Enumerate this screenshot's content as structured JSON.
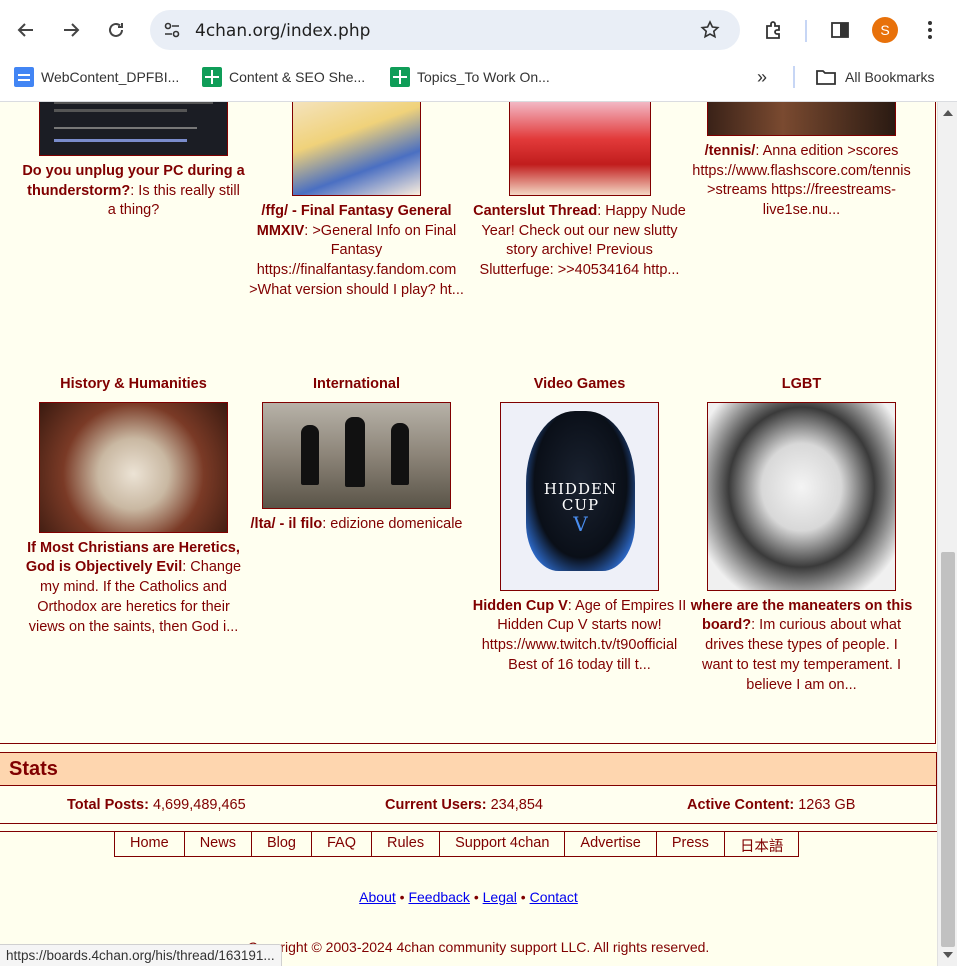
{
  "browser": {
    "url": "4chan.org/index.php",
    "profile_initial": "S",
    "bookmarks": [
      {
        "label": "WebContent_DPFBI...",
        "icon": "docs-icon"
      },
      {
        "label": "Content & SEO She...",
        "icon": "sheets-icon"
      },
      {
        "label": "Topics_To Work On...",
        "icon": "sheets-icon"
      }
    ],
    "all_bookmarks": "All Bookmarks",
    "overflow": "»"
  },
  "top_row": [
    {
      "title": "Do you unplug your PC during a thunderstorm?",
      "text": ": Is this really still a thing?"
    },
    {
      "title": "/ffg/ - Final Fantasy General MMXIV",
      "text": ": >General Info on Final Fantasy https://finalfantasy.fandom.com >What version should I play? ht..."
    },
    {
      "title": "Canterslut Thread",
      "text": ": Happy Nude Year! Check out our new slutty story archive! Previous Slutterfuge: >>40534164 http..."
    },
    {
      "title": "/tennis/",
      "text": ": Anna edition >scores https://www.flashscore.com/tennis >streams https://freestreams-live1se.nu..."
    }
  ],
  "bottom_row": [
    {
      "board": "History & Humanities",
      "title": "If Most Christians are Heretics, God is Objectively Evil",
      "text": ": Change my mind. If the Catholics and Orthodox are heretics for their views on the saints, then God i..."
    },
    {
      "board": "International",
      "title": "/lta/ - il filo",
      "text": ": edizione domenicale"
    },
    {
      "board": "Video Games",
      "title": "Hidden Cup V",
      "text": ": Age of Empires II Hidden Cup V starts now! https://www.twitch.tv/t90official Best of 16 today till t..."
    },
    {
      "board": "LGBT",
      "title": "where are the maneaters on this board?",
      "text": ": Im curious about what drives these types of people. I want to test my temperament. I believe I am on..."
    }
  ],
  "stats": {
    "header": "Stats",
    "total_posts_label": "Total Posts:",
    "total_posts": "4,699,489,465",
    "current_users_label": "Current Users:",
    "current_users": "234,854",
    "active_content_label": "Active Content:",
    "active_content": "1263 GB"
  },
  "footer_nav": [
    "Home",
    "News",
    "Blog",
    "FAQ",
    "Rules",
    "Support 4chan",
    "Advertise",
    "Press",
    "日本語"
  ],
  "footer_links": {
    "about": "About",
    "feedback": "Feedback",
    "legal": "Legal",
    "contact": "Contact",
    "sep": "•"
  },
  "copyright": "Copyright © 2003-2024 4chan community support LLC. All rights reserved.",
  "status_url": "https://boards.4chan.org/his/thread/163191...",
  "colors": {
    "maroon": "#800000",
    "page_bg": "#ffffee",
    "header_bg": "#fed6af",
    "link_blue": "#0000ee"
  }
}
